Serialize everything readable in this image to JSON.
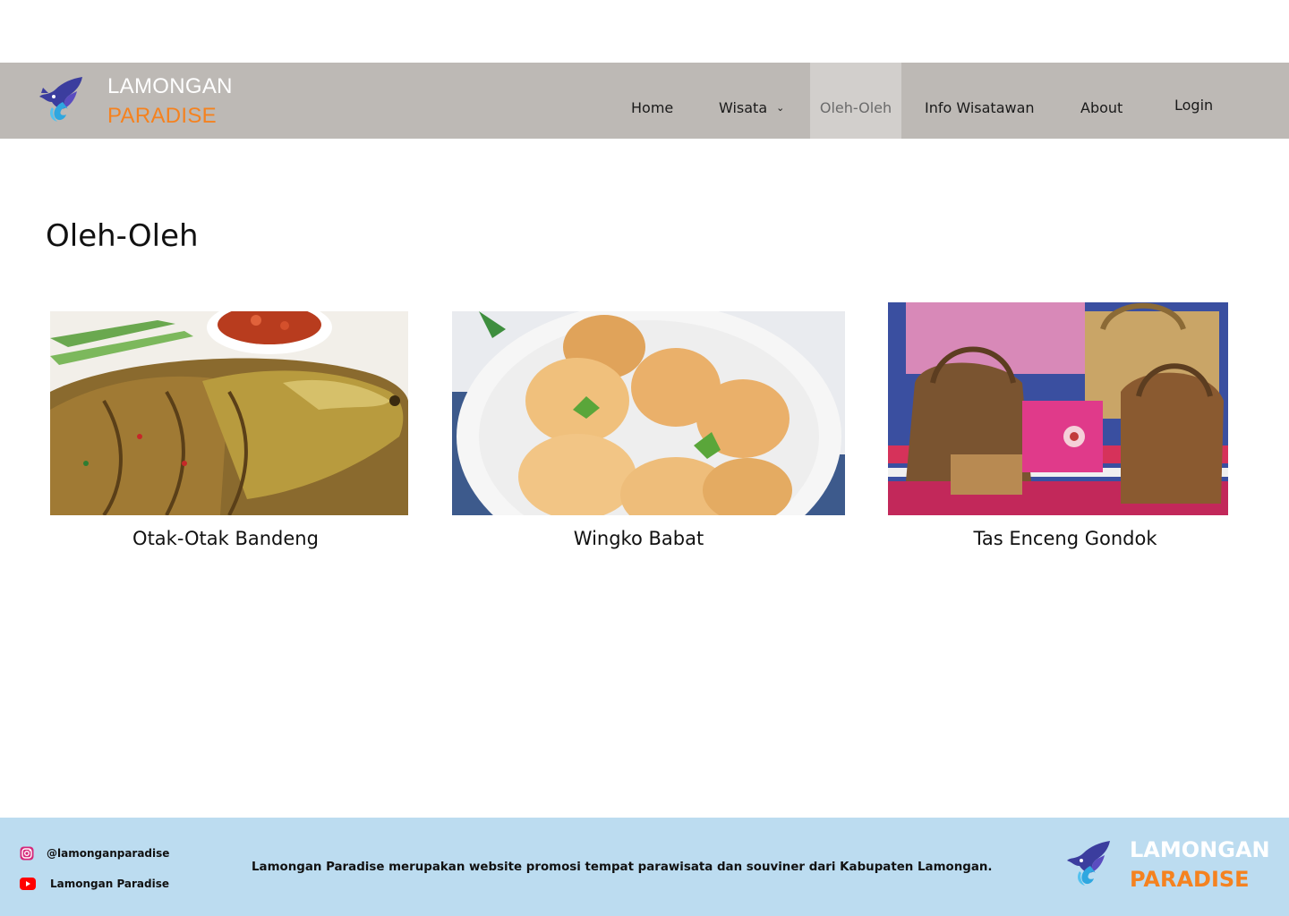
{
  "header": {
    "brand_line1": "LAMONGAN",
    "brand_line2": "PARADISE",
    "logo_icon": "fish-logo-icon",
    "nav": [
      {
        "label": "Home"
      },
      {
        "label": "Wisata",
        "has_dropdown": true
      },
      {
        "label": "Oleh-Oleh",
        "active": true
      },
      {
        "label": "Info Wisatawan"
      },
      {
        "label": "About"
      }
    ],
    "login_label": "Login"
  },
  "main": {
    "title": "Oleh-Oleh",
    "cards": [
      {
        "caption": "Otak-Otak Bandeng",
        "image": "grilled-milkfish-photo"
      },
      {
        "caption": "Wingko Babat",
        "image": "coconut-cakes-photo"
      },
      {
        "caption": "Tas Enceng Gondok",
        "image": "woven-bags-photo"
      }
    ]
  },
  "footer": {
    "instagram_handle": "@lamonganparadise",
    "youtube_channel": "Lamongan Paradise",
    "description": "Lamongan Paradise merupakan website promosi tempat parawisata dan souviner dari Kabupaten Lamongan.",
    "brand_line1": "LAMONGAN",
    "brand_line2": "PARADISE"
  },
  "colors": {
    "header_bg": "#bdb9b5",
    "active_nav_bg": "#d2cfcc",
    "accent_orange": "#f5821f",
    "footer_bg": "#bcdcf0"
  }
}
